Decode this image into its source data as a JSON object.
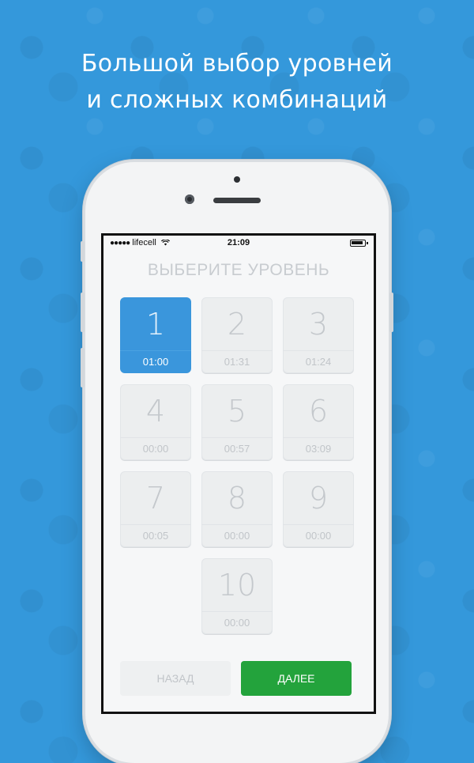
{
  "headline": {
    "line1": "Большой выбор уровней",
    "line2": "и сложных комбинаций"
  },
  "statusbar": {
    "signal": "●●●●●",
    "carrier": "lifecell",
    "time": "21:09"
  },
  "screen": {
    "title": "ВЫБЕРИТЕ УРОВЕНЬ",
    "levels": [
      {
        "number": "1",
        "time": "01:00",
        "selected": true
      },
      {
        "number": "2",
        "time": "01:31"
      },
      {
        "number": "3",
        "time": "01:24"
      },
      {
        "number": "4",
        "time": "00:00"
      },
      {
        "number": "5",
        "time": "00:57"
      },
      {
        "number": "6",
        "time": "03:09"
      },
      {
        "number": "7",
        "time": "00:05"
      },
      {
        "number": "8",
        "time": "00:00"
      },
      {
        "number": "9",
        "time": "00:00"
      },
      {
        "number": "10",
        "time": "00:00"
      }
    ],
    "back_label": "НАЗАД",
    "next_label": "ДАЛЕЕ"
  },
  "colors": {
    "background": "#3498db",
    "selected_tile": "#3a96dc",
    "next_button": "#23a33c"
  }
}
